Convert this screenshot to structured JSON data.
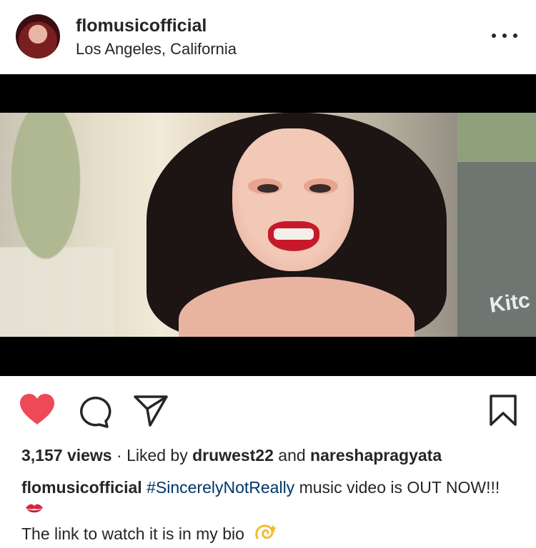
{
  "post": {
    "username": "flomusicofficial",
    "location": "Los Angeles, California",
    "media_overlay_text": "Kitc"
  },
  "engagement": {
    "views": "3,157 views",
    "separator": " · ",
    "liked_by_prefix": "Liked by ",
    "liker_1": "druwest22",
    "and": " and ",
    "liker_2": "nareshapragyata"
  },
  "caption": {
    "username": "flomusicofficial",
    "hashtag": "#SincerelyNotReally",
    "text": " music video is OUT NOW!!!",
    "line2": "The link to watch it is in my bio"
  },
  "icons": {
    "more": "more-options-icon",
    "like": "heart-icon",
    "comment": "comment-icon",
    "share": "share-icon",
    "save": "bookmark-icon"
  },
  "colors": {
    "like_active": "#ed4956",
    "hashtag": "#003569",
    "text": "#262626"
  }
}
